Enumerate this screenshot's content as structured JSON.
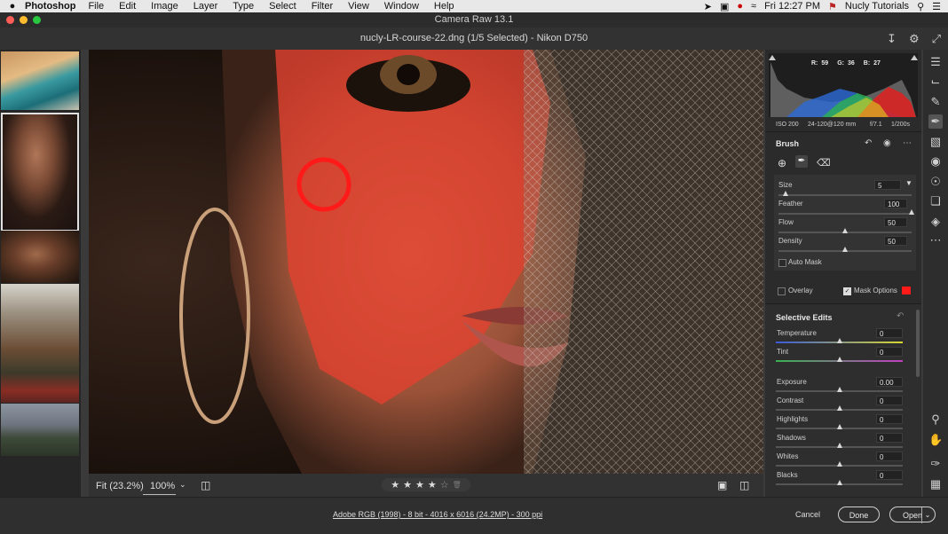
{
  "menubar": {
    "app_name": "Photoshop",
    "items": [
      "File",
      "Edit",
      "Image",
      "Layer",
      "Type",
      "Select",
      "Filter",
      "View",
      "Window",
      "Help"
    ],
    "clock": "Fri 12:27 PM",
    "user": "Nucly Tutorials"
  },
  "window": {
    "title": "Camera Raw 13.1"
  },
  "document": {
    "title": "nucly-LR-course-22.dng (1/5 Selected)  -  Nikon D750"
  },
  "histogram": {
    "r_label": "R:",
    "r_value": "59",
    "g_label": "G:",
    "g_value": "36",
    "b_label": "B:",
    "b_value": "27"
  },
  "camera_info": {
    "iso": "ISO 200",
    "lens": "24-120@120 mm",
    "aperture": "f/7.1",
    "shutter": "1/200s"
  },
  "brush": {
    "title": "Brush",
    "sliders": [
      {
        "label": "Size",
        "value": "5",
        "level": 0.05
      },
      {
        "label": "Feather",
        "value": "100",
        "level": 1.0
      },
      {
        "label": "Flow",
        "value": "50",
        "level": 0.5
      },
      {
        "label": "Density",
        "value": "50",
        "level": 0.5
      }
    ],
    "auto_mask_label": "Auto Mask",
    "overlay_label": "Overlay",
    "mask_options_label": "Mask Options",
    "mask_color": "#ff1a1a"
  },
  "selective_edits": {
    "title": "Selective Edits",
    "sliders": [
      {
        "label": "Temperature",
        "value": "0"
      },
      {
        "label": "Tint",
        "value": "0"
      },
      {
        "label": "Exposure",
        "value": "0.00"
      },
      {
        "label": "Contrast",
        "value": "0"
      },
      {
        "label": "Highlights",
        "value": "0"
      },
      {
        "label": "Shadows",
        "value": "0"
      },
      {
        "label": "Whites",
        "value": "0"
      },
      {
        "label": "Blacks",
        "value": "0"
      }
    ]
  },
  "bottom_bar": {
    "fit": "Fit (23.2%)",
    "zoom": "100%",
    "rating_stars": 4,
    "rating_max": 5
  },
  "footer": {
    "file_info": "Adobe RGB (1998) - 8 bit - 4016 x 6016 (24.2MP) - 300 ppi",
    "cancel": "Cancel",
    "done": "Done",
    "open": "Open"
  }
}
